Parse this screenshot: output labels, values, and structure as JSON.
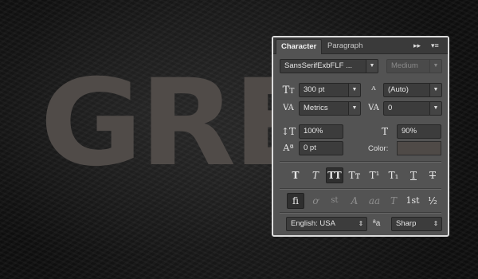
{
  "canvas": {
    "text": "GRE"
  },
  "panel": {
    "tabs": [
      "Character",
      "Paragraph"
    ],
    "controls": {
      "expand_icon": "double-arrow-right",
      "menu_icon": "panel-menu"
    },
    "font_family": "SansSerifExbFLF ...",
    "font_style": "Medium",
    "font_size": "300 pt",
    "leading": "(Auto)",
    "kerning": "Metrics",
    "tracking": "0",
    "vertical_scale": "100%",
    "horizontal_scale": "90%",
    "baseline_shift": "0 pt",
    "color_label": "Color:",
    "text_color": "#4f4a47",
    "style_buttons": [
      "T",
      "T",
      "TT",
      "Tт",
      "T¹",
      "T₁",
      "T",
      "T"
    ],
    "opentype_buttons": [
      "ﬁ",
      "ơ",
      "st",
      "A",
      "aa",
      "T",
      "1st",
      "½"
    ],
    "language": "English: USA",
    "aa_icon": "ªa",
    "antialias": "Sharp"
  }
}
